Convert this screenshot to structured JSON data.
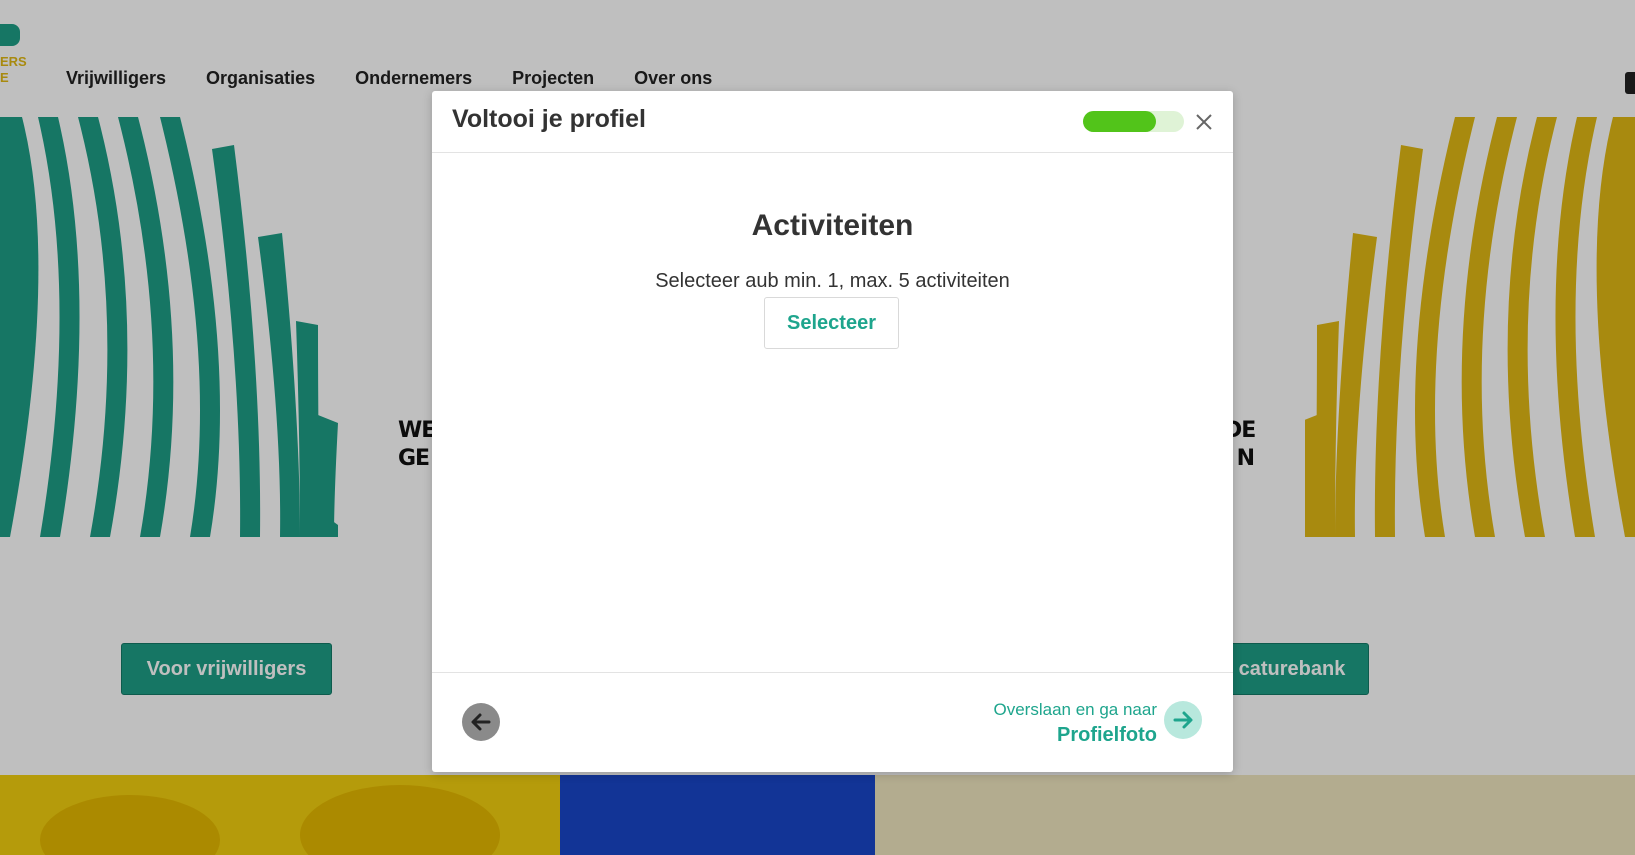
{
  "header": {
    "logo_text_1": "ERS",
    "logo_text_2": "E",
    "nav": [
      "Vrijwilligers",
      "Organisaties",
      "Ondernemers",
      "Projecten",
      "Over ons"
    ]
  },
  "hero": {
    "left_text_1": "WEL",
    "left_text_2": "GE",
    "right_text_1": "DE",
    "right_text_2": "N",
    "left_cta": "Voor vrijwilligers",
    "right_cta": "caturebank",
    "colors": {
      "teal": "#1e9e86",
      "yellow": "#e1b915"
    }
  },
  "modal": {
    "title": "Voltooi je profiel",
    "progress": 0.72,
    "section_title": "Activiteiten",
    "section_subtitle": "Selecteer aub min. 1, max. 5 activiteiten",
    "select_button": "Selecteer",
    "skip_text": "Overslaan en ga naar",
    "next_step": "Profielfoto",
    "icons": {
      "close": "close-icon",
      "back": "arrow-left-icon",
      "next": "arrow-right-icon"
    }
  }
}
